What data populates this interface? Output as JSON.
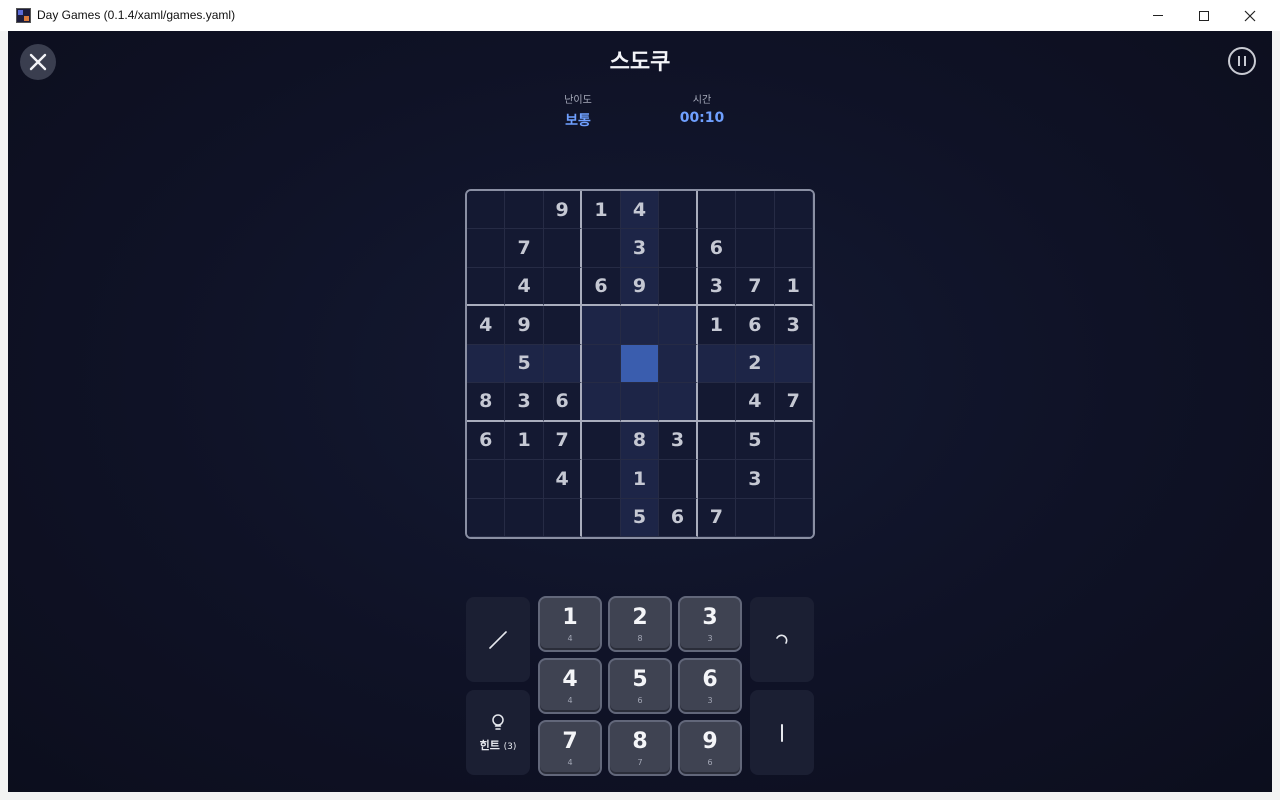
{
  "window": {
    "title": "Day Games (0.1.4/xaml/games.yaml)"
  },
  "header": {
    "title": "스도쿠",
    "difficulty_label": "난이도",
    "difficulty_value": "보통",
    "time_label": "시간",
    "time_value": "00:10"
  },
  "colors": {
    "background": "#0f1226",
    "accent": "#6fa0ff",
    "selected_cell": "#3a5dae",
    "highlight_cell": "#1d2547"
  },
  "board": {
    "selected": {
      "row": 4,
      "col": 4
    },
    "cells": [
      [
        "",
        "",
        "9",
        "1",
        "4",
        "",
        "",
        "",
        ""
      ],
      [
        "",
        "7",
        "",
        "",
        "3",
        "",
        "6",
        "",
        ""
      ],
      [
        "",
        "4",
        "",
        "6",
        "9",
        "",
        "3",
        "7",
        "1"
      ],
      [
        "4",
        "9",
        "",
        "",
        "",
        "",
        "1",
        "6",
        "3"
      ],
      [
        "",
        "5",
        "",
        "",
        "",
        "",
        "",
        "2",
        ""
      ],
      [
        "8",
        "3",
        "6",
        "",
        "",
        "",
        "",
        "4",
        "7"
      ],
      [
        "6",
        "1",
        "7",
        "",
        "8",
        "3",
        "",
        "5",
        ""
      ],
      [
        "",
        "",
        "4",
        "",
        "1",
        "",
        "",
        "3",
        ""
      ],
      [
        "",
        "",
        "",
        "",
        "5",
        "6",
        "7",
        "",
        ""
      ]
    ]
  },
  "numpad": [
    {
      "digit": "1",
      "count": "4"
    },
    {
      "digit": "2",
      "count": "8"
    },
    {
      "digit": "3",
      "count": "3"
    },
    {
      "digit": "4",
      "count": "4"
    },
    {
      "digit": "5",
      "count": "6"
    },
    {
      "digit": "6",
      "count": "3"
    },
    {
      "digit": "7",
      "count": "4"
    },
    {
      "digit": "8",
      "count": "7"
    },
    {
      "digit": "9",
      "count": "6"
    }
  ],
  "controls": {
    "hint_label": "힌트",
    "hint_count": "(3)",
    "icons": {
      "close": "close-icon",
      "pause": "pause-icon",
      "pencil": "pencil-icon",
      "hint": "lightbulb-icon",
      "undo": "undo-icon",
      "erase": "eraser-icon"
    }
  }
}
